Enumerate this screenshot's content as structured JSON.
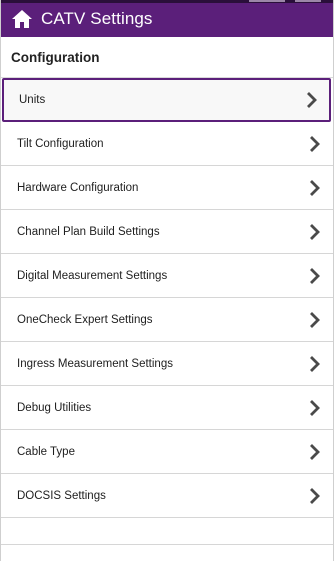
{
  "app": {
    "title": "CATV Settings"
  },
  "section": {
    "title": "Configuration"
  },
  "items": [
    {
      "label": "Units",
      "selected": true
    },
    {
      "label": "Tilt Configuration",
      "selected": false
    },
    {
      "label": "Hardware Configuration",
      "selected": false
    },
    {
      "label": "Channel Plan Build Settings",
      "selected": false
    },
    {
      "label": "Digital Measurement Settings",
      "selected": false
    },
    {
      "label": "OneCheck Expert Settings",
      "selected": false
    },
    {
      "label": "Ingress Measurement Settings",
      "selected": false
    },
    {
      "label": "Debug Utilities",
      "selected": false
    },
    {
      "label": "Cable Type",
      "selected": false
    },
    {
      "label": "DOCSIS Settings",
      "selected": false
    }
  ],
  "icons": {
    "home": "home-icon",
    "row_arrow": "chevron-right-icon"
  },
  "colors": {
    "titlebar": "#5b1f7a",
    "title_text": "#ffffff",
    "selected_border": "#5b1f7a",
    "chevron": "#4a4a4a"
  }
}
